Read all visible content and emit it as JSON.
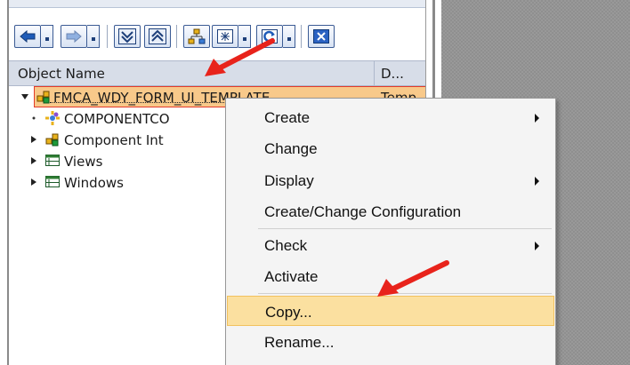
{
  "toolbar": {
    "buttons": [
      {
        "icon": "back-arrow-icon"
      },
      {
        "icon": "forward-arrow-icon"
      },
      {
        "icon": "expand-all-icon"
      },
      {
        "icon": "collapse-all-icon"
      },
      {
        "icon": "hierarchy-icon"
      },
      {
        "icon": "select-icon"
      },
      {
        "icon": "refresh-icon"
      },
      {
        "icon": "close-icon"
      }
    ]
  },
  "tree": {
    "columns": {
      "name": "Object Name",
      "desc": "D..."
    },
    "root": {
      "label": "FMCA_WDY_FORM_UI_TEMPLATE",
      "type": "Temp"
    },
    "children": [
      {
        "label": "COMPONENTCO",
        "icon": "component-controller-icon"
      },
      {
        "label": "Component Int",
        "icon": "component-interface-icon"
      },
      {
        "label": "Views",
        "icon": "views-icon"
      },
      {
        "label": "Windows",
        "icon": "windows-icon"
      }
    ]
  },
  "context_menu": {
    "items": [
      {
        "label": "Create",
        "submenu": true
      },
      {
        "label": "Change",
        "submenu": false
      },
      {
        "label": "Display",
        "submenu": true
      },
      {
        "label": "Create/Change Configuration",
        "submenu": false
      },
      {
        "label": "Check",
        "submenu": true
      },
      {
        "label": "Activate",
        "submenu": false
      },
      {
        "label": "Copy...",
        "submenu": false,
        "highlighted": true
      },
      {
        "label": "Rename...",
        "submenu": false
      }
    ]
  },
  "colors": {
    "highlight": "#fbe0a0",
    "annotation_arrow": "#e8231b",
    "selected_row": "#f8c98a"
  }
}
